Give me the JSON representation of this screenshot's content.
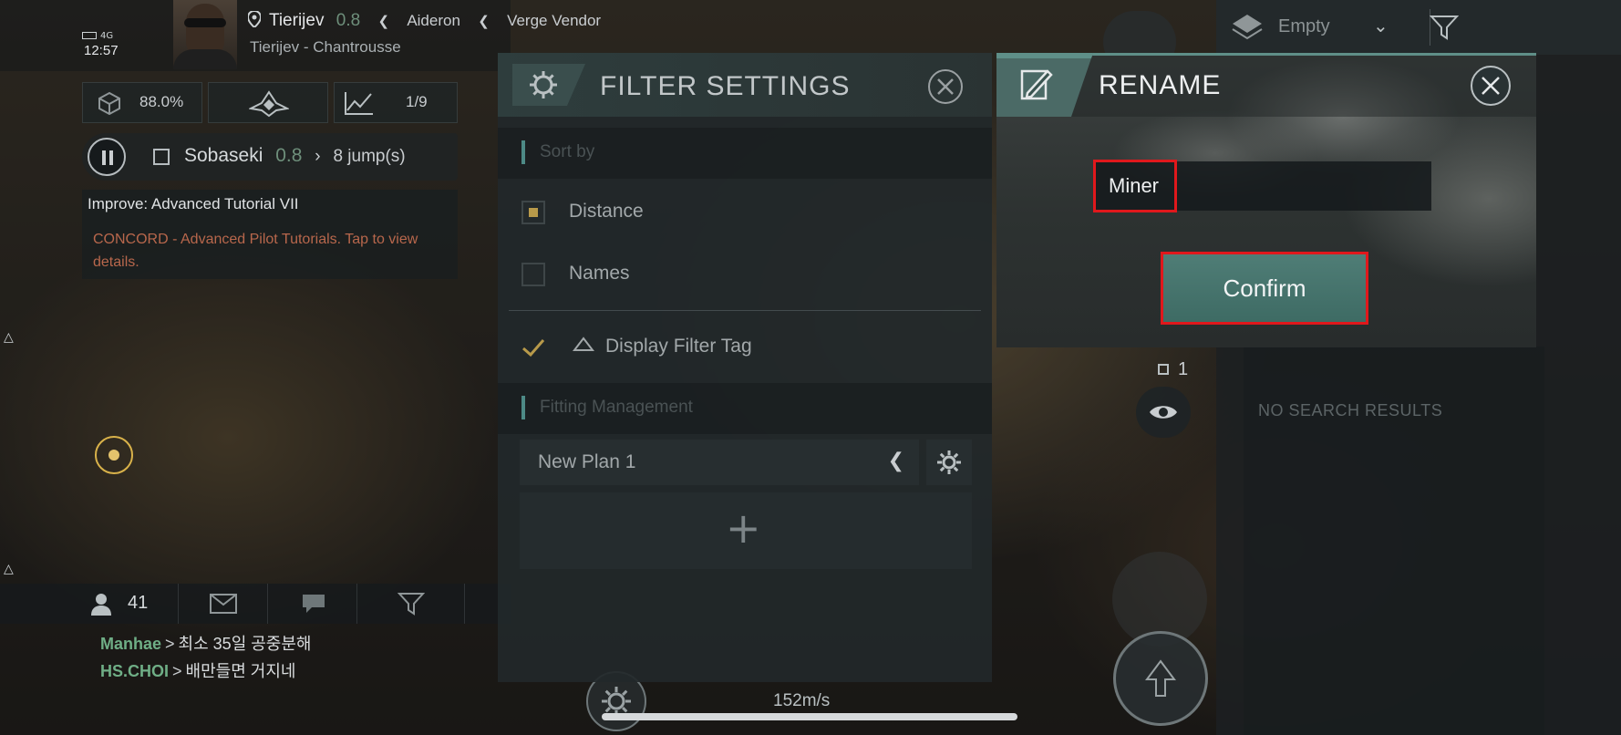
{
  "hud": {
    "network": "4G",
    "clock": "12:57",
    "location": {
      "system": "Tierijev",
      "security": "0.8",
      "region": "Aideron",
      "area": "Verge Vendor",
      "sublocation": "Tierijev - Chantrousse"
    },
    "stats": {
      "cargo": "88.0%",
      "progress": "1/9"
    },
    "route": {
      "destination": "Sobaseki",
      "security": "0.8",
      "jumps": "8 jump(s)"
    },
    "mission": {
      "title": "Improve: Advanced Tutorial VII",
      "description": "CONCORD - Advanced Pilot Tutorials. Tap to view details."
    }
  },
  "chat": {
    "member_count": "41",
    "messages": [
      {
        "sender": "Manhae",
        "separator": ">",
        "text": "최소 35일 공중분해"
      },
      {
        "sender": "HS.CHOI",
        "separator": ">",
        "text": "배만들면 거지네"
      }
    ]
  },
  "filter_settings": {
    "title": "FILTER SETTINGS",
    "sort_section": "Sort by",
    "sort_options": [
      {
        "label": "Distance",
        "checked": true
      },
      {
        "label": "Names",
        "checked": false
      }
    ],
    "display_filter_tag": {
      "label": "Display Filter Tag",
      "checked": true
    },
    "fitting_section": "Fitting Management",
    "plan_name": "New Plan 1",
    "add_symbol": "+"
  },
  "rename_dialog": {
    "title": "RENAME",
    "input_value": "Miner",
    "confirm_label": "Confirm"
  },
  "right_panel": {
    "dropdown_value": "Empty",
    "no_results": "NO SEARCH RESULTS",
    "count": "1"
  },
  "ship": {
    "speed": "152m/s"
  },
  "colors": {
    "accent_teal": "#4f7d76",
    "highlight_red": "#e0181c",
    "security_green": "#6e8f7b",
    "chat_name_green": "#6fae86",
    "mission_orange": "#b8674c"
  },
  "icons": {
    "location": "map-pin-icon",
    "cargo": "cube-icon",
    "ship_overview": "ship-icon",
    "chart": "chart-line-icon",
    "filter_gear": "gear-icon",
    "rename": "edit-note-icon",
    "close": "close-icon",
    "eye": "eye-icon",
    "warp": "warp-icon",
    "filter": "filter-icon"
  }
}
